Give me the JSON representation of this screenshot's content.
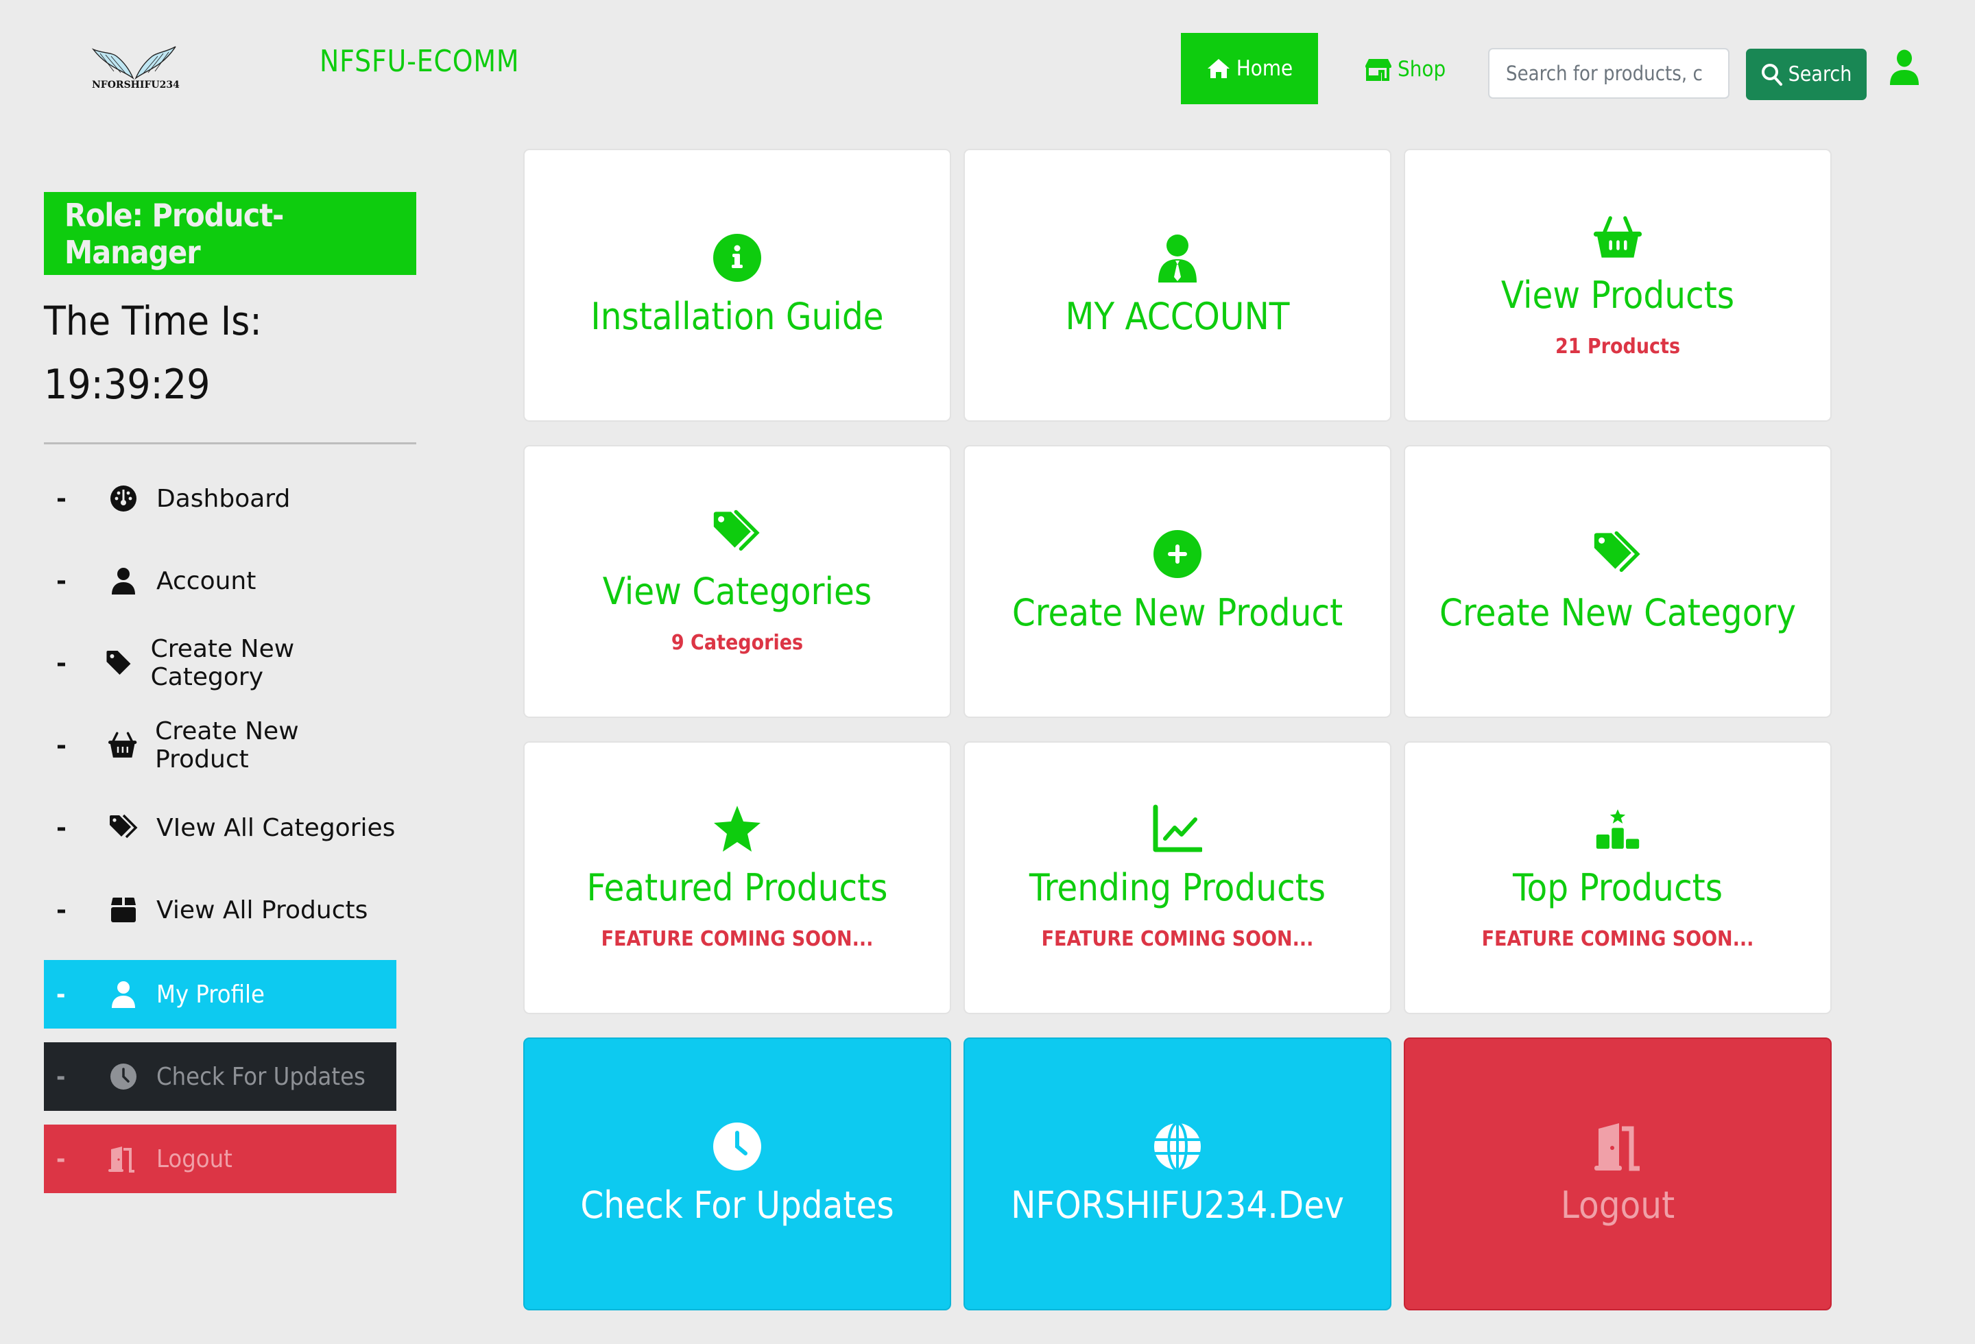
{
  "header": {
    "logo_text": "NFORSHIFU234",
    "brand_title": "NFSFU-ECOMM",
    "nav": {
      "home_label": "Home",
      "home_icon": "home-icon",
      "shop_label": "Shop",
      "shop_icon": "store-icon"
    },
    "search": {
      "placeholder": "Search for products, c",
      "value": "",
      "button_label": "Search",
      "button_icon": "search-icon"
    },
    "user_icon": "user-icon"
  },
  "sidebar": {
    "role_label": "Role: Product-Manager",
    "time_label": "The Time Is:",
    "time_value": "19:39:29",
    "items": [
      {
        "dash": "-",
        "icon": "dashboard-gauge-icon",
        "label": "Dashboard"
      },
      {
        "dash": "-",
        "icon": "user-icon",
        "label": "Account"
      },
      {
        "dash": "-",
        "icon": "tag-icon",
        "label": "Create New Category"
      },
      {
        "dash": "-",
        "icon": "basket-icon",
        "label": "Create New Product"
      },
      {
        "dash": "-",
        "icon": "tags-icon",
        "label": "VIew All Categories"
      },
      {
        "dash": "-",
        "icon": "box-icon",
        "label": "View All Products"
      },
      {
        "dash": "-",
        "icon": "user-icon",
        "label": "My Profile"
      },
      {
        "dash": "-",
        "icon": "clock-icon",
        "label": "Check For Updates"
      },
      {
        "dash": "-",
        "icon": "door-open-icon",
        "label": "Logout"
      }
    ]
  },
  "cards": [
    {
      "icon": "info-circle-icon",
      "title": "Installation Guide",
      "subtitle": ""
    },
    {
      "icon": "user-tie-icon",
      "title": "MY ACCOUNT",
      "subtitle": ""
    },
    {
      "icon": "basket-icon",
      "title": "View Products",
      "subtitle": "21 Products"
    },
    {
      "icon": "tags-icon",
      "title": "View Categories",
      "subtitle": "9 Categories"
    },
    {
      "icon": "plus-circle-icon",
      "title": "Create New Product",
      "subtitle": ""
    },
    {
      "icon": "tags-icon",
      "title": "Create New Category",
      "subtitle": ""
    },
    {
      "icon": "star-icon",
      "title": "Featured Products",
      "subtitle": "FEATURE COMING SOON..."
    },
    {
      "icon": "chart-line-icon",
      "title": "Trending Products",
      "subtitle": "FEATURE COMING SOON..."
    },
    {
      "icon": "ranking-star-icon",
      "title": "Top Products",
      "subtitle": "FEATURE COMING SOON..."
    },
    {
      "icon": "clock-icon",
      "title": "Check For Updates",
      "subtitle": ""
    },
    {
      "icon": "globe-icon",
      "title": "NFORSHIFU234.Dev",
      "subtitle": ""
    },
    {
      "icon": "door-open-icon",
      "title": "Logout",
      "subtitle": ""
    }
  ],
  "colors": {
    "brand_green": "#0ecc0e",
    "search_button": "#198754",
    "info": "#0dcaf0",
    "dark": "#212529",
    "danger": "#dc3545",
    "background": "#ebebeb"
  }
}
